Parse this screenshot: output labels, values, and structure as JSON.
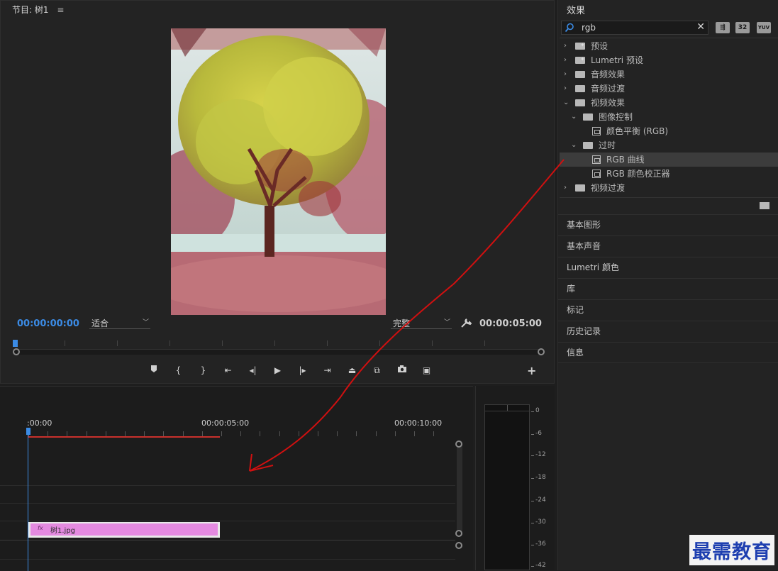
{
  "monitor": {
    "tab_title": "节目: 树1",
    "menu_glyph": "≡",
    "current_time": "00:00:00:00",
    "fit_select": "适合",
    "quality_select": "完整",
    "duration": "00:00:05:00",
    "transport": [
      "mark-in",
      "mark-in-brace",
      "mark-out-brace",
      "go-to-in",
      "step-back",
      "play",
      "step-forward",
      "go-to-out",
      "lift",
      "extract",
      "export-frame",
      "compare"
    ]
  },
  "timeline": {
    "ruler_labels": [
      ":00:00",
      "00:00:05:00",
      "00:00:10:00"
    ],
    "clip_fx": "fx",
    "clip_name": "树1.jpg"
  },
  "meter": {
    "db_labels": [
      "0",
      "-6",
      "-12",
      "-18",
      "-24",
      "-30",
      "-36",
      "-42"
    ]
  },
  "effects": {
    "title": "效果",
    "search_value": "rgb",
    "clear_glyph": "✕",
    "toolbar_icons": [
      "accelerated-effects-icon",
      "32-bit-color-icon",
      "yuv-effects-icon"
    ],
    "toolbar_labels": [
      "⇶",
      "32",
      "YUV"
    ],
    "tree": [
      {
        "label": "预设",
        "level": 0,
        "expanded": false,
        "type": "star-folder"
      },
      {
        "label": "Lumetri 预设",
        "level": 0,
        "expanded": false,
        "type": "star-folder"
      },
      {
        "label": "音频效果",
        "level": 0,
        "expanded": false,
        "type": "folder"
      },
      {
        "label": "音频过渡",
        "level": 0,
        "expanded": false,
        "type": "folder"
      },
      {
        "label": "视频效果",
        "level": 0,
        "expanded": true,
        "type": "folder"
      },
      {
        "label": "图像控制",
        "level": 1,
        "expanded": true,
        "type": "folder"
      },
      {
        "label": "颜色平衡 (RGB)",
        "level": 2,
        "type": "effect"
      },
      {
        "label": "过时",
        "level": 1,
        "expanded": true,
        "type": "folder"
      },
      {
        "label": "RGB 曲线",
        "level": 2,
        "type": "effect",
        "selected": true
      },
      {
        "label": "RGB 颜色校正器",
        "level": 2,
        "type": "effect"
      },
      {
        "label": "视频过渡",
        "level": 0,
        "expanded": false,
        "type": "folder"
      }
    ],
    "panels": [
      "基本图形",
      "基本声音",
      "Lumetri 颜色",
      "库",
      "标记",
      "历史记录",
      "信息"
    ]
  },
  "watermark": "最需教育",
  "colors": {
    "accent_blue": "#3b8be5",
    "clip_pink": "#e48ae0",
    "annotation_red": "#d01010",
    "work_area_red": "#c9302c"
  }
}
